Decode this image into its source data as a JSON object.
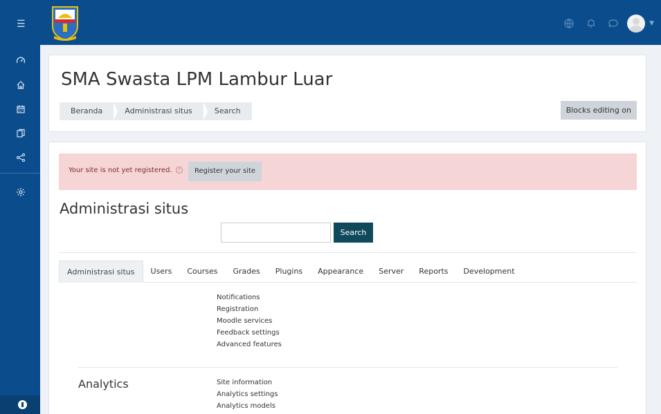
{
  "navbar": {
    "menu_icon": "hamburger-icon",
    "logo": "school-crest-logo",
    "icons": [
      "globe-icon",
      "bell-icon",
      "chat-icon"
    ],
    "user_avatar": "avatar",
    "user_menu_caret": "chevron-down-icon"
  },
  "sidebar": {
    "items": [
      {
        "icon": "dashboard-icon"
      },
      {
        "icon": "home-icon"
      },
      {
        "icon": "calendar-icon"
      },
      {
        "icon": "files-icon"
      },
      {
        "icon": "share-icon"
      },
      {
        "icon": "gear-icon"
      }
    ],
    "footer_icon": "accessibility-icon"
  },
  "header": {
    "site_title": "SMA Swasta LPM Lambur Luar",
    "breadcrumb": [
      "Beranda",
      "Administrasi situs",
      "Search"
    ],
    "blocks_editing_label": "Blocks editing on"
  },
  "alert": {
    "text": "Your site is not yet registered.",
    "help_glyph": "?",
    "register_button": "Register your site"
  },
  "main": {
    "heading": "Administrasi situs",
    "search": {
      "value": "",
      "button_label": "Search"
    },
    "tabs": [
      {
        "label": "Administrasi situs",
        "active": true
      },
      {
        "label": "Users",
        "active": false
      },
      {
        "label": "Courses",
        "active": false
      },
      {
        "label": "Grades",
        "active": false
      },
      {
        "label": "Plugins",
        "active": false
      },
      {
        "label": "Appearance",
        "active": false
      },
      {
        "label": "Server",
        "active": false
      },
      {
        "label": "Reports",
        "active": false
      },
      {
        "label": "Development",
        "active": false
      }
    ],
    "general_links": [
      "Notifications",
      "Registration",
      "Moodle services",
      "Feedback settings",
      "Advanced features"
    ],
    "analytics": {
      "title": "Analytics",
      "links": [
        "Site information",
        "Analytics settings",
        "Analytics models"
      ]
    }
  },
  "colors": {
    "navbar": "#0b4d8c",
    "alert_bg": "#f6d5d7",
    "search_button": "#0f4a5c",
    "secondary_button": "#ced4da"
  }
}
